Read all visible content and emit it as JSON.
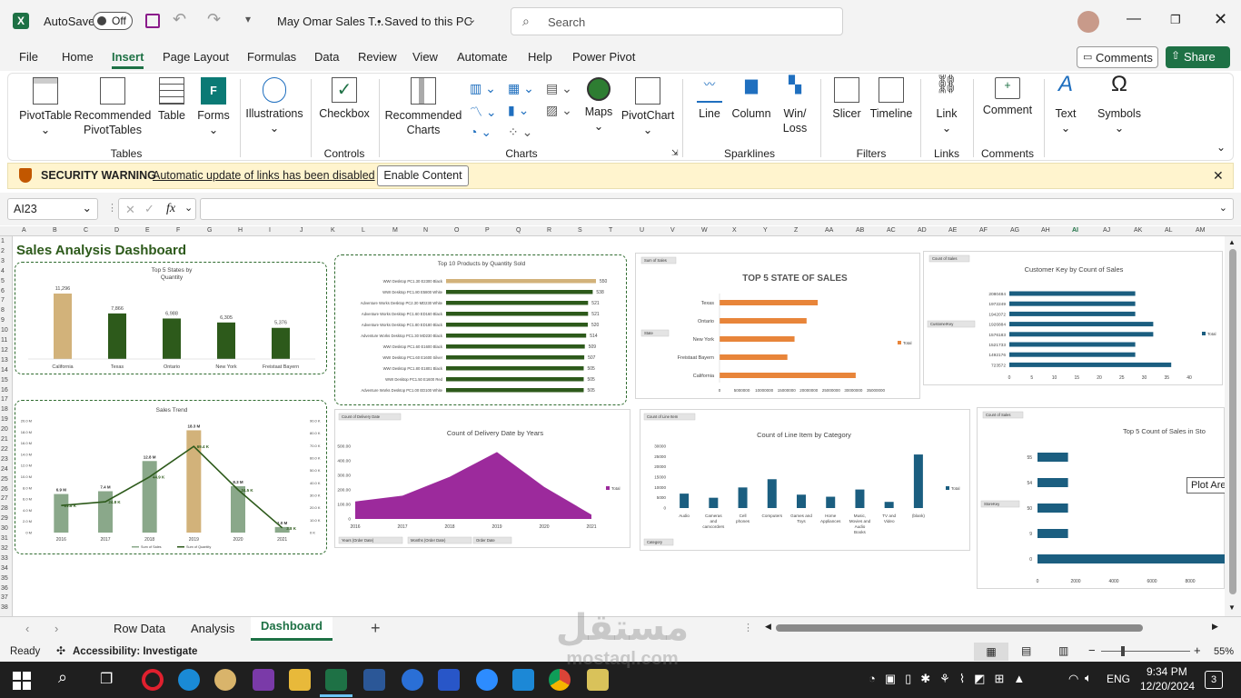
{
  "window": {
    "autosave_label": "AutoSave",
    "autosave_state": "Off",
    "doc_title": "May Omar Sales T...",
    "save_status": "• Saved to this PC",
    "search_placeholder": "Search"
  },
  "menu_tabs": [
    "File",
    "Home",
    "Insert",
    "Page Layout",
    "Formulas",
    "Data",
    "Review",
    "View",
    "Automate",
    "Help",
    "Power Pivot"
  ],
  "comments_label": "Comments",
  "share_label": "Share",
  "ribbon": {
    "pivottable": "PivotTable",
    "recommended_pivottables": "Recommended PivotTables",
    "table": "Table",
    "forms": "Forms",
    "illustrations": "Illustrations",
    "checkbox": "Checkbox",
    "recommended_charts": "Recommended Charts",
    "maps": "Maps",
    "pivotchart": "PivotChart",
    "line": "Line",
    "column": "Column",
    "winloss": "Win/ Loss",
    "slicer": "Slicer",
    "timeline": "Timeline",
    "link": "Link",
    "comment": "Comment",
    "text": "Text",
    "symbols": "Symbols",
    "groups": {
      "tables": "Tables",
      "controls": "Controls",
      "charts": "Charts",
      "sparklines": "Sparklines",
      "filters": "Filters",
      "links": "Links",
      "comments": "Comments"
    }
  },
  "security": {
    "title": "SECURITY WARNING",
    "message": "Automatic update of links has been disabled",
    "button": "Enable Content"
  },
  "formula_bar": {
    "name_box": "AI23",
    "fx": "fx",
    "formula": ""
  },
  "columns": [
    "A",
    "B",
    "C",
    "D",
    "E",
    "F",
    "G",
    "H",
    "I",
    "J",
    "K",
    "L",
    "M",
    "N",
    "O",
    "P",
    "Q",
    "R",
    "S",
    "T",
    "U",
    "V",
    "W",
    "X",
    "Y",
    "Z",
    "AA",
    "AB",
    "AC",
    "AD",
    "AE",
    "AF",
    "AG",
    "AH",
    "AI",
    "AJ",
    "AK",
    "AL",
    "AM"
  ],
  "dashboard_title": "Sales Analysis Dashboard",
  "tooltip": "Plot Area",
  "sheets": [
    "Row Data",
    "Analysis",
    "Dashboard"
  ],
  "active_sheet": "Dashboard",
  "status": {
    "ready": "Ready",
    "accessibility": "Accessibility: Investigate",
    "zoom": "55%"
  },
  "taskbar": {
    "lang": "ENG",
    "time": "9:34 PM",
    "date": "12/20/2024",
    "notif": "3"
  },
  "watermark": {
    "arabic": "مستقل",
    "latin": "mostaql.com"
  },
  "colors": {
    "excel_green": "#1e7145",
    "dark_green": "#2d5a1b",
    "tan": "#d2b27a",
    "sage": "#8aa88a",
    "orange": "#e8853a",
    "purple": "#9c2a9c",
    "teal": "#1b5e80"
  },
  "chart_data": [
    {
      "type": "bar",
      "title": "Top 5 States by Quantity",
      "categories": [
        "California",
        "Texas",
        "Ontario",
        "New York",
        "Freistaat Bayern"
      ],
      "values": [
        11296,
        7866,
        6988,
        6305,
        5376
      ],
      "labels": [
        "11,296",
        "7,866",
        "6,988",
        "6,305",
        "5,376"
      ]
    },
    {
      "type": "bar",
      "title": "Top 10 Products by Quantity Sold",
      "categories": [
        "WWI Desktop PC1.30 E2300 Black",
        "WWI Desktop PC1.80 E5800 White",
        "Adventure Works Desktop PC2.30 MD230 White",
        "Adventure Works Desktop PC1.60 ED160 Black",
        "Adventure Works Desktop PC1.80 ED180 Black",
        "Adventure Works Desktop PC1.30 MD230 Black",
        "WWI Desktop PC1.60 E1600 Black",
        "WWI Desktop PC1.60 E1600 Silver",
        "WWI Desktop PC1.80 E1801 Black",
        "WWI Desktop PC1.50 E1600 Red",
        "Adventure Works Desktop PC1.00 ED100 White"
      ],
      "values": [
        550,
        538,
        521,
        521,
        520,
        514,
        509,
        507,
        505,
        505,
        505
      ]
    },
    {
      "type": "bar",
      "title": "TOP 5 STATE OF SALES",
      "field_button": "Sum of Sales",
      "axis_button": "State",
      "legend": "Total",
      "categories": [
        "Texas",
        "Ontario",
        "New York",
        "Freistaat Bayern",
        "California"
      ],
      "values": [
        22000000,
        19500000,
        16800000,
        15200000,
        30500000
      ],
      "ticks": [
        "0",
        "5000000",
        "10000000",
        "15000000",
        "20000000",
        "25000000",
        "30000000",
        "35000000"
      ]
    },
    {
      "type": "bar",
      "title": "Customer Key by Count of Sales",
      "field_button": "Count of Sales",
      "axis_button": "CustomerKey",
      "legend": "Total",
      "categories": [
        "2080484",
        "1972249",
        "1942072",
        "1926884",
        "1576183",
        "1521733",
        "1492176",
        "723572"
      ],
      "values": [
        28,
        28,
        28,
        32,
        32,
        28,
        28,
        36
      ],
      "ticks": [
        "0",
        "5",
        "10",
        "15",
        "20",
        "25",
        "30",
        "35",
        "40"
      ]
    },
    {
      "type": "line",
      "title": "Sales Trend",
      "x": [
        "2016",
        "2017",
        "2018",
        "2019",
        "2020",
        "2021"
      ],
      "series": [
        {
          "name": "Sum of Sales",
          "values": [
            6.9,
            7.4,
            12.8,
            18.3,
            8.3,
            1.0
          ],
          "labels": [
            "6.9 M",
            "7.4 M",
            "12.8 M",
            "18.3 M",
            "8.3 M",
            "1.0 M"
          ]
        },
        {
          "name": "Sum of Quantity",
          "values": [
            21.8,
            24.8,
            44.9,
            69.4,
            34.5,
            3.8
          ],
          "labels": [
            "21.8 K",
            "24.8 K",
            "44.9 K",
            "69.4 K",
            "34.5 K",
            "3.8 K"
          ]
        }
      ],
      "left_ticks": [
        "0 M",
        "2.0 M",
        "4.0 M",
        "6.0 M",
        "8.0 M",
        "10.0 M",
        "12.0 M",
        "14.0 M",
        "16.0 M",
        "18.0 M",
        "20.0 M"
      ],
      "right_ticks": [
        "0 K",
        "10.0 K",
        "20.0 K",
        "30.0 K",
        "40.0 K",
        "50.0 K",
        "60.0 K",
        "70.0 K",
        "80.0 K",
        "90.0 K"
      ]
    },
    {
      "type": "area",
      "title": "Count of Delivery Date by Years",
      "field_button": "Count of Delivery Date",
      "legend": "Total",
      "x": [
        "2016",
        "2017",
        "2018",
        "2019",
        "2020",
        "2021"
      ],
      "values": [
        1200,
        1600,
        2900,
        4600,
        2200,
        300
      ],
      "ticks": [
        "0",
        "100.00",
        "200.00",
        "300.00",
        "400.00",
        "500.00"
      ],
      "buttons": [
        "Years (Order Date)",
        "Months (Order Date)",
        "Order Date"
      ]
    },
    {
      "type": "bar",
      "title": "Count of Line Item by Category",
      "field_button": "Count of Line Item",
      "legend": "Total",
      "axis_button": "Category",
      "categories": [
        "Audio",
        "Cameras and camcorders",
        "Cell phones",
        "Computers",
        "Games and Toys",
        "Home Appliances",
        "Music, Movies and Audio Books",
        "TV and Video",
        "(blank)"
      ],
      "values": [
        7000,
        5000,
        10000,
        14000,
        6500,
        5500,
        9000,
        3000,
        26000
      ],
      "ticks": [
        "0",
        "5000",
        "10000",
        "15000",
        "20000",
        "25000",
        "30000"
      ]
    },
    {
      "type": "bar",
      "title": "Top 5 Count of Sales  in Sto",
      "field_button": "Count of Sales",
      "axis_button": "StoreKey",
      "categories": [
        "55",
        "54",
        "50",
        "9",
        "0"
      ],
      "values": [
        1600,
        1600,
        1600,
        1600,
        10000
      ],
      "ticks": [
        "0",
        "2000",
        "4000",
        "6000",
        "8000"
      ]
    }
  ]
}
